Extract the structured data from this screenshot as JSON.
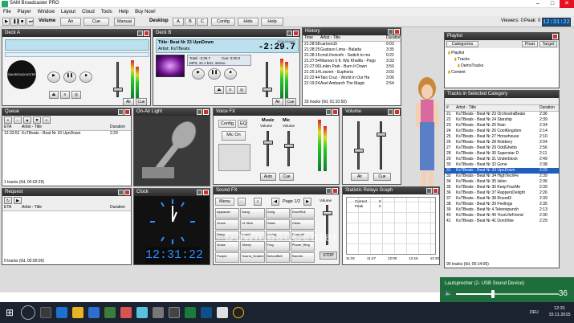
{
  "app": {
    "title": "SAM Broadcaster PRO",
    "menu": [
      "File",
      "Player",
      "Window",
      "Layout",
      "Cloud",
      "Tools",
      "Help",
      "Buy Now!"
    ],
    "viewers_label": "Viewers: 0",
    "peak_label": "Peak: 0",
    "clock": "12:31:22"
  },
  "toolbar": {
    "volume_label": "Volume",
    "air_label": "Air",
    "cue_label": "Cue",
    "manual_label": "Manual",
    "desktop_label": "Desktop",
    "desktop_a": "A",
    "desktop_b": "B",
    "desktop_c": "C",
    "config_label": "Config",
    "hide_label": "Hide",
    "help_label": "Help"
  },
  "deck_a": {
    "title": "Deck A",
    "logo_text": "SAM BROADCASTER",
    "air_btn": "Air",
    "cue_btn": "Cue"
  },
  "deck_b": {
    "title": "Deck B",
    "track_title": "Title: Beat Nr 33  UpnDown",
    "track_artist": "Artist: KsTBeats",
    "remaining_label": "REMAINING",
    "remaining": "-2:29.7",
    "total": "Total: -2:29.7",
    "cue": "Cue: 0:00.0",
    "format": "MP3, 44.1 kHz, stereo",
    "air_btn": "Air",
    "cue_btn": "Cue"
  },
  "history": {
    "title": "History",
    "columns": [
      "Time",
      "Artist - Title",
      "Duration"
    ],
    "rows": [
      [
        "21:28:58",
        "cartoon2t",
        "0:03"
      ],
      [
        "21:28:25",
        "Gustavo Lima - Balada",
        "3:35"
      ],
      [
        "21:28:16",
        "cmd://voicefx - Switch to mo",
        "0:22"
      ],
      [
        "21:27:54",
        "Maroon 5 ft. Wiz Khalifa - Payp",
        "3:33"
      ],
      [
        "21:27:00",
        "Linkin Park - Burn It Down",
        "3:50"
      ],
      [
        "21:25:14",
        "Loaven - Euphoria",
        "3:03"
      ],
      [
        "21:22:44",
        "Taio Cruz - World in Our Ha",
        "3:06"
      ],
      [
        "21:19:24",
        "Axel Ambarch The Magic",
        "2:54"
      ]
    ],
    "footer": "33 tracks (0d, 01:10:50)"
  },
  "playlist": {
    "title": "Playlist",
    "categories_label": "Categories",
    "float_label": "Float",
    "target_label": "Target",
    "tree": [
      "Playlist",
      "Tracks",
      "DemoTracks",
      "Content"
    ]
  },
  "tracks_in_category": {
    "title": "Tracks in Selected Category",
    "columns": [
      "#",
      "Artist - Title",
      "Duration"
    ],
    "rows": [
      [
        "21",
        "KsTBeats - Beat Nr 23  OrchestraBeats",
        "2:36"
      ],
      [
        "22",
        "KsTBeats - Beat Nr 24  Starship",
        "2:39"
      ],
      [
        "23",
        "KsTBeats - Beat Nr 25  Rain",
        "2:34"
      ],
      [
        "24",
        "KsTBeats - Beat Nr 26  CoolKingdom",
        "2:14"
      ],
      [
        "25",
        "KsTBeats - Beat Nr 27  Horsehouse",
        "2:10"
      ],
      [
        "26",
        "KsTBeats - Beat Nr 28  Robbery",
        "2:04"
      ],
      [
        "27",
        "KsTBeats - Beat Nr 29  OddGhetto",
        "2:56"
      ],
      [
        "28",
        "KsTBeats - Beat Nr 30  Superstar D",
        "2:11"
      ],
      [
        "29",
        "KsTBeats - Beat Nr 31  Underblock",
        "2:49"
      ],
      [
        "30",
        "KsTBeats - Beat Nr 32  Gone",
        "2:38"
      ],
      [
        "31",
        "KsTBeats - Beat Nr 33  UpnDown",
        "2:29"
      ],
      [
        "33",
        "KsTBeats - Beat Nr 34  HighTechFe",
        "2:39"
      ],
      [
        "34",
        "KsTBeats - Beat Nr 35  Isilen",
        "2:36"
      ],
      [
        "35",
        "KsTBeats - Beat Nr 36  KeepYourMe",
        "2:39"
      ],
      [
        "36",
        "KsTBeats - Beat Nr 37  RappersDelight",
        "2:26"
      ],
      [
        "37",
        "KsTBeats - Beat Nr 38  Round3",
        "2:39"
      ],
      [
        "38",
        "KsTBeats - Beat Nr 39  Feelings",
        "2:35"
      ],
      [
        "39",
        "KsTBeats - Beat Nr 4  Teknoxpunch",
        "2:13"
      ],
      [
        "40",
        "KsTBeats - Beat Nr 40  YourLifeFriend",
        "2:30"
      ],
      [
        "41",
        "KsTBeats - Beat Nr 41  DontVibe",
        "2:29"
      ]
    ],
    "selected_index": 10,
    "footer": "90 tracks (0d, 05:14:05)"
  },
  "queue": {
    "title": "Queue",
    "columns": [
      "ETA",
      "Artist - Title",
      "Duration"
    ],
    "rows": [
      [
        "12:33:52",
        "KsTBeats - Beat Nr 33  UpnDown",
        "2:29"
      ]
    ],
    "footer": "1 tracks (0d, 00:02:29)"
  },
  "request": {
    "title": "Request",
    "columns": [
      "ETA",
      "Artist - Title",
      "Duration"
    ],
    "footer": "0 tracks (0d, 00:00:00)"
  },
  "on_air_light": {
    "title": "On-Air Light"
  },
  "clock_panel": {
    "title": "Clock",
    "digital": "12:31:22"
  },
  "voice_fx": {
    "title": "Voice FX",
    "config_btn": "Config",
    "eq_btn": "EQ",
    "mic_on_btn": "Mic On",
    "music_label": "Music",
    "mic_label": "Mic",
    "volume_label": "Volume",
    "auto_btn": "Auto",
    "cue_btn": "Cue"
  },
  "sound_fx": {
    "title": "Sound FX",
    "menu_label": "Menu",
    "page_label": "Page 1/2",
    "volume_label": "Volume",
    "stop_label": "STOP",
    "buttons": [
      "Applause",
      "Dang",
      "Gong",
      "DrumRoll",
      "Grans",
      "Lil Stick",
      "Glass",
      "Clicks",
      "Dang",
      "Laugh",
      "Loving",
      "Doorbell",
      "Grass",
      "Sheep",
      "Frog",
      "Phone_Ring",
      "Pooper",
      "Sound_Scratch",
      "SchoolBell",
      "Swords"
    ]
  },
  "volume_panel": {
    "title": "Volume",
    "air_btn": "Air",
    "cue_btn": "Cue"
  },
  "relays": {
    "title": "Statistic Relays Graph",
    "legend": [
      [
        "Current",
        "0"
      ],
      [
        "Peak",
        "0"
      ]
    ],
    "x_labels": [
      "11:32",
      "11:47",
      "12:00",
      "12:15",
      "12:30"
    ]
  },
  "volume_popup": {
    "device": "Lautsprecher (2- USB Sound Device)",
    "level": 36,
    "level_text": "36"
  },
  "taskbar": {
    "time": "12:31",
    "date": "15.11.2015",
    "lang": "DEU"
  },
  "watermark": "DownloadCenter"
}
